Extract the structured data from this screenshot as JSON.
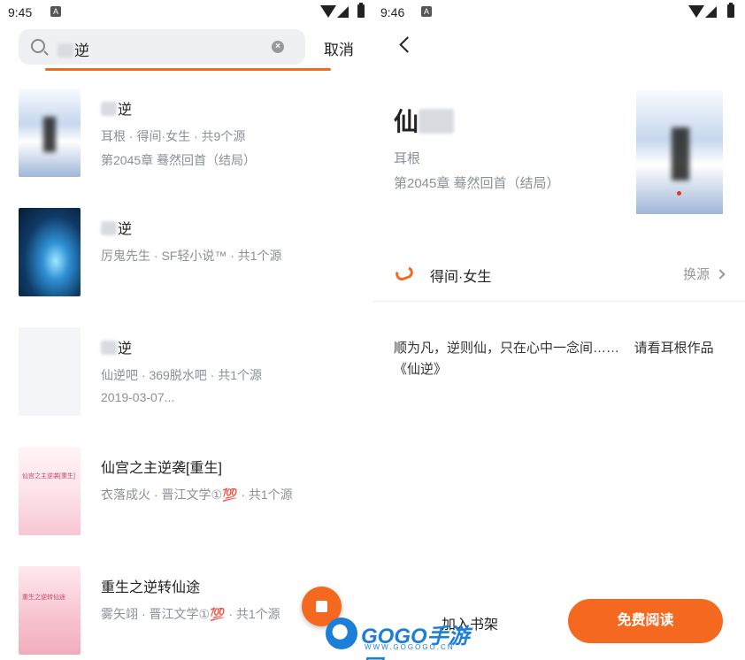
{
  "left": {
    "status": {
      "time": "9:45"
    },
    "search": {
      "query": "逆"
    },
    "cancel_label": "取消",
    "results": [
      {
        "title": "逆",
        "title_blurred": true,
        "meta": "耳根 · 得间·女生 · 共9个源",
        "extra": "第2045章 蓦然回首（结局）",
        "cover": "sky"
      },
      {
        "title": "逆",
        "title_blurred": true,
        "meta": "厉鬼先生 · SF轻小说™ · 共1个源",
        "extra": "",
        "cover": "blue"
      },
      {
        "title": "逆",
        "title_blurred": true,
        "meta": "仙逆吧 · 369脱水吧 · 共1个源",
        "extra": "2019-03-07...",
        "cover": "empty"
      },
      {
        "title": "仙宫之主逆袭[重生]",
        "title_blurred": false,
        "meta": "衣落成火 · 晋江文学①💯 · 共1个源",
        "extra": "",
        "cover": "pink",
        "cover_text": "仙宫之主逆袭[重生]"
      },
      {
        "title": "重生之逆转仙途",
        "title_blurred": false,
        "meta": "雾矢翊 · 晋江文学①💯 · 共1个源",
        "extra": "",
        "cover": "red",
        "cover_text": "重生之逆转仙途"
      }
    ]
  },
  "right": {
    "status": {
      "time": "9:46"
    },
    "book": {
      "title": "仙",
      "author": "耳根",
      "latest_chapter": "第2045章 蓦然回首（结局）"
    },
    "source": {
      "name": "得间·女生",
      "switch_label": "换源"
    },
    "description": "顺为凡，逆则仙，只在心中一念间……    请看耳根作品《仙逆》",
    "add_shelf_label": "加入书架",
    "read_label": "免费阅读"
  },
  "watermark": {
    "brand": "GOGO手游网",
    "url": "WWW.GOGOGO.CN"
  },
  "colors": {
    "accent": "#f4691f",
    "secondary_text": "#8a8f99",
    "watermark_blue": "#1c7ed6"
  }
}
